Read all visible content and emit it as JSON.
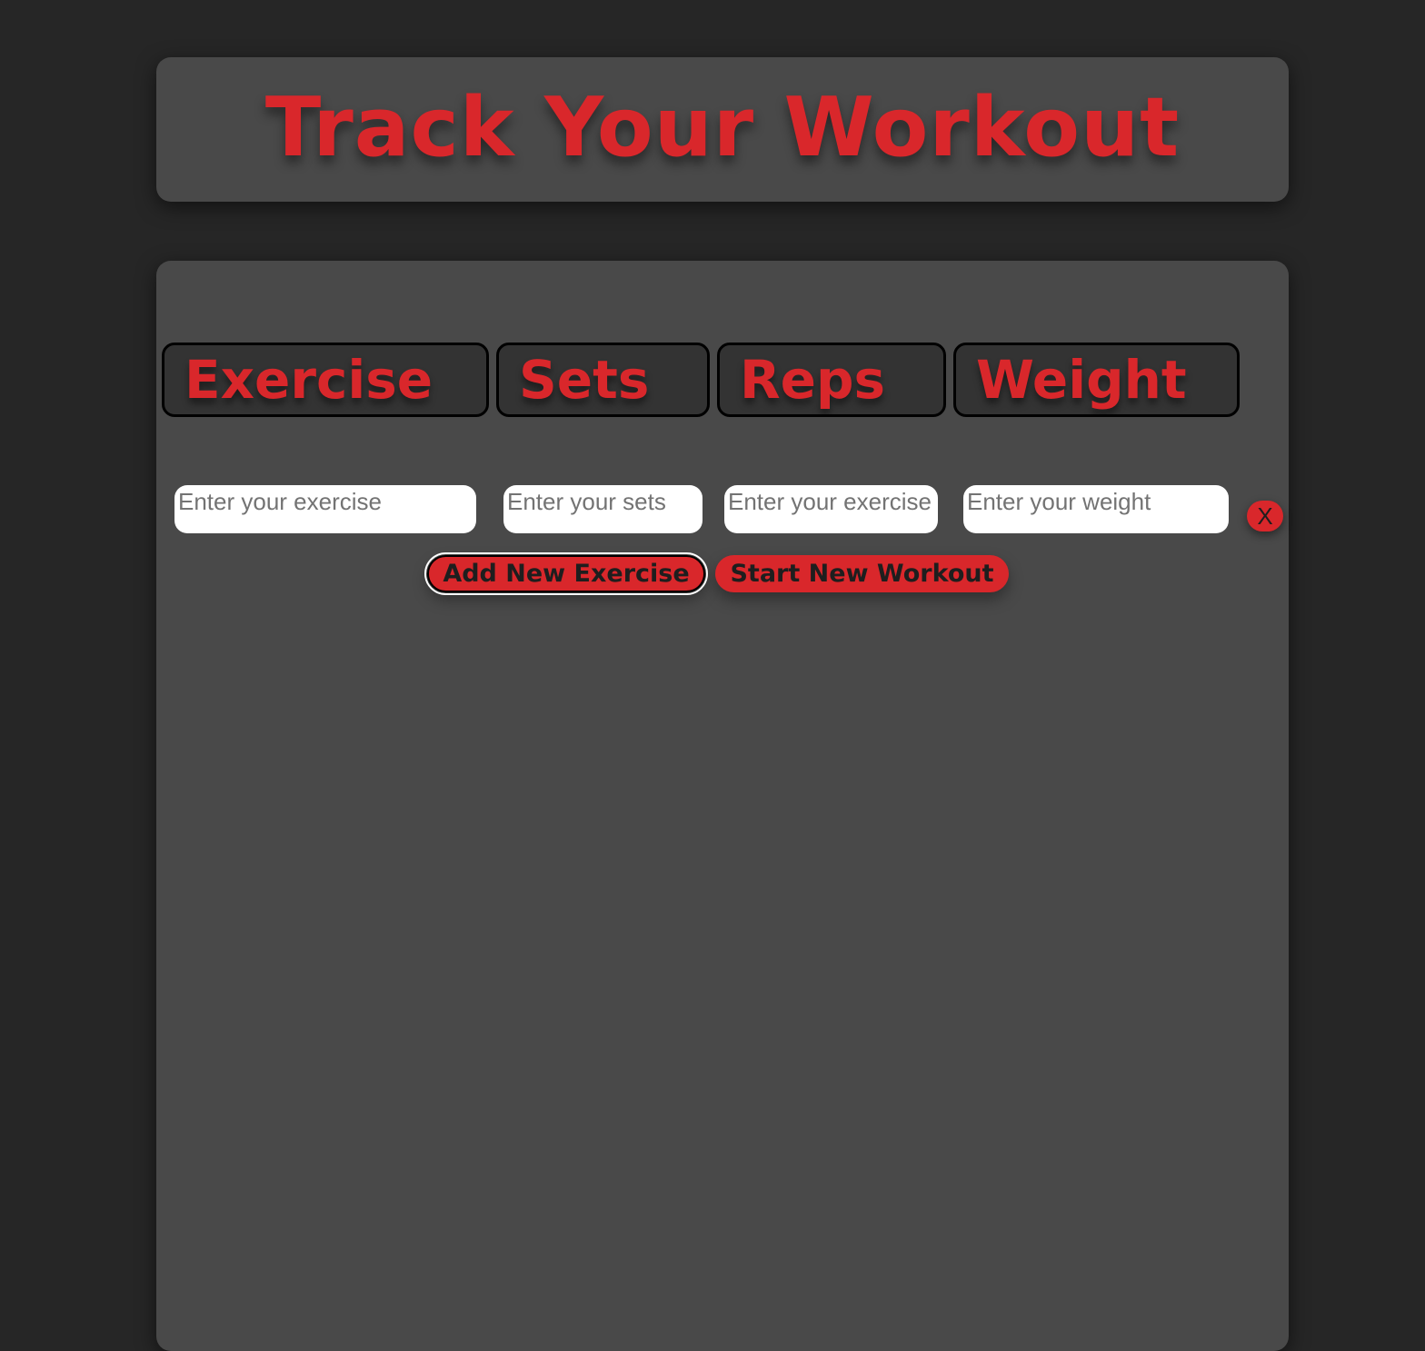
{
  "header": {
    "title": "Track Your Workout"
  },
  "columns": {
    "exercise": "Exercise",
    "sets": "Sets",
    "reps": "Reps",
    "weight": "Weight"
  },
  "row": {
    "exercise_placeholder": "Enter your exercise",
    "sets_placeholder": "Enter your sets",
    "reps_placeholder": "Enter your exercise",
    "weight_placeholder": "Enter your weight",
    "remove_label": "X"
  },
  "actions": {
    "add_label": "Add New Exercise",
    "start_label": "Start New Workout"
  },
  "colors": {
    "accent": "#d9272b",
    "panel": "#494949",
    "background": "#262626"
  }
}
